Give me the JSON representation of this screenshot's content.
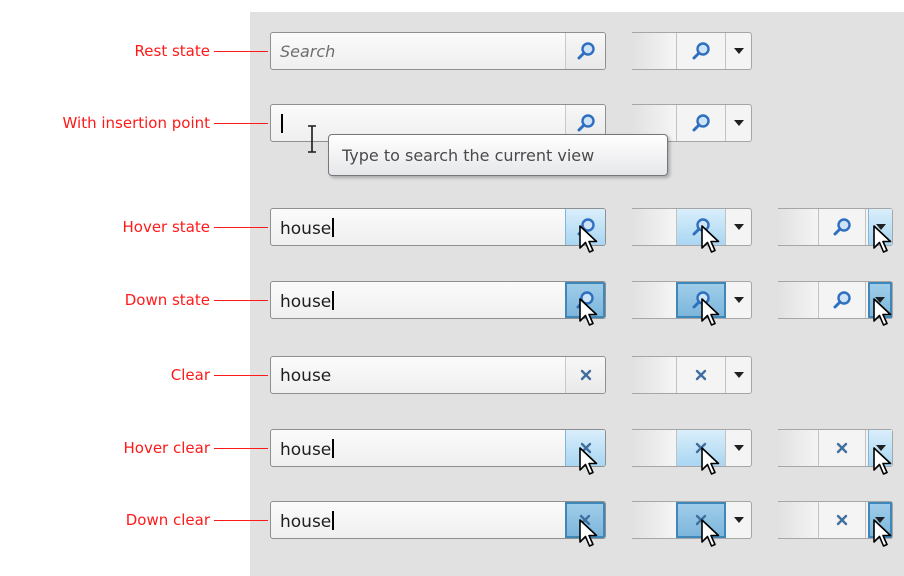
{
  "states": [
    {
      "label": "Rest state",
      "text": "",
      "placeholder": "Search",
      "icon": "search"
    },
    {
      "label": "With insertion point",
      "text": "",
      "placeholder": "",
      "icon": "search"
    },
    {
      "label": "Hover state",
      "text": "house",
      "placeholder": "",
      "icon": "search"
    },
    {
      "label": "Down state",
      "text": "house",
      "placeholder": "",
      "icon": "search"
    },
    {
      "label": "Clear",
      "text": "house",
      "placeholder": "",
      "icon": "clear"
    },
    {
      "label": "Hover clear",
      "text": "house",
      "placeholder": "",
      "icon": "clear"
    },
    {
      "label": "Down clear",
      "text": "house",
      "placeholder": "",
      "icon": "clear"
    }
  ],
  "tooltip": "Type to search the current view",
  "colors": {
    "annotation": "#ff1a1a",
    "panel_background": "#e1e1e1",
    "hover_fill": "#a9d6f2",
    "pressed_border": "#3f87b9",
    "icon_blue": "#2f6fc0"
  },
  "icons": {
    "search": "magnifier-icon",
    "clear": "clear-x-icon",
    "dropdown": "dropdown-arrow-icon",
    "pointer": "mouse-pointer-icon"
  }
}
